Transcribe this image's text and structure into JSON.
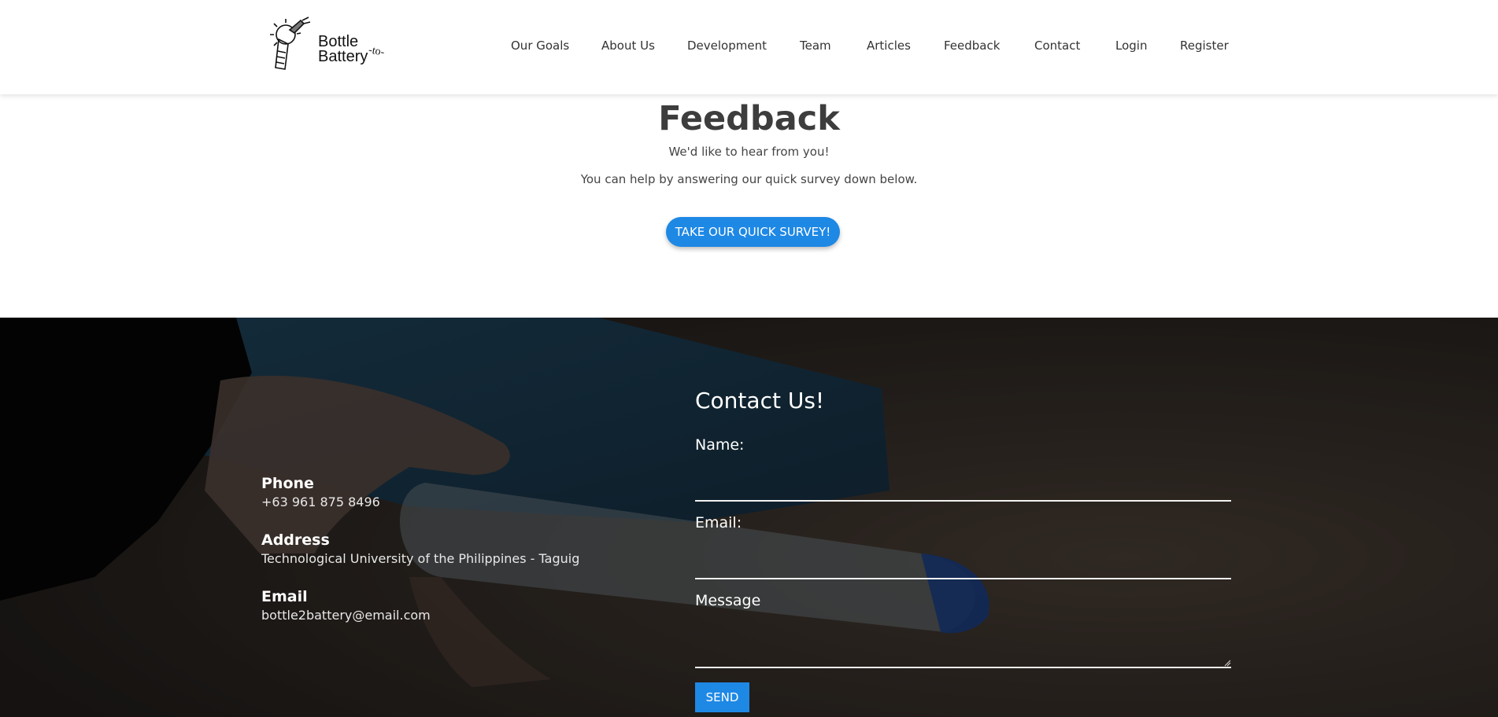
{
  "header": {
    "logo": {
      "line1": "Bottle",
      "line2": "Battery",
      "connector": "-to-",
      "icon": "lightbulb-bottle-icon"
    },
    "nav": [
      {
        "label": "Our Goals"
      },
      {
        "label": "About Us"
      },
      {
        "label": "Development"
      },
      {
        "label": "Team"
      },
      {
        "label": "Articles"
      },
      {
        "label": "Feedback"
      },
      {
        "label": "Contact"
      },
      {
        "label": "Login"
      },
      {
        "label": "Register"
      }
    ]
  },
  "feedback": {
    "title": "Feedback",
    "subtitle": "We'd like to hear from you!",
    "help_text": "You can help by answering our quick survey down below.",
    "survey_button": "TAKE OUR QUICK SURVEY!"
  },
  "contact_info": {
    "phone_label": "Phone",
    "phone_value": "+63 961 875 8496",
    "address_label": "Address",
    "address_value": "Technological University of the Philippines - Taguig",
    "email_label": "Email",
    "email_value": "bottle2battery@email.com"
  },
  "contact_form": {
    "title": "Contact Us!",
    "name_label": "Name:",
    "name_value": "",
    "email_label": "Email:",
    "email_value": "",
    "message_label": "Message",
    "message_value": "",
    "send_button": "SEND"
  },
  "colors": {
    "accent": "#1e88e5",
    "footer_overlay": "#1d1d1d",
    "heading": "#3d3d3d"
  }
}
